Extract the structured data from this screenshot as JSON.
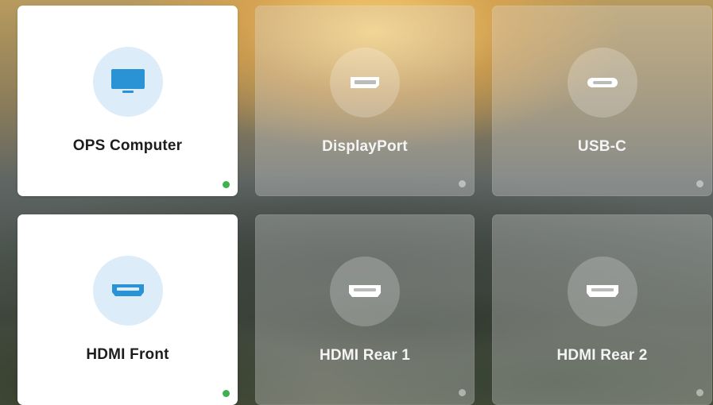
{
  "colors": {
    "active_icon": "#2a93d5",
    "inactive_icon": "#ffffff",
    "status_on": "#3fb14f"
  },
  "sources": [
    {
      "label": "OPS Computer",
      "icon": "monitor-icon",
      "active": true,
      "status": "connected"
    },
    {
      "label": "DisplayPort",
      "icon": "displayport-icon",
      "active": false,
      "status": "disconnected"
    },
    {
      "label": "USB-C",
      "icon": "usb-c-icon",
      "active": false,
      "status": "disconnected"
    },
    {
      "label": "HDMI Front",
      "icon": "hdmi-icon",
      "active": true,
      "status": "connected"
    },
    {
      "label": "HDMI Rear 1",
      "icon": "hdmi-icon",
      "active": false,
      "status": "disconnected"
    },
    {
      "label": "HDMI Rear 2",
      "icon": "hdmi-icon",
      "active": false,
      "status": "disconnected"
    }
  ]
}
